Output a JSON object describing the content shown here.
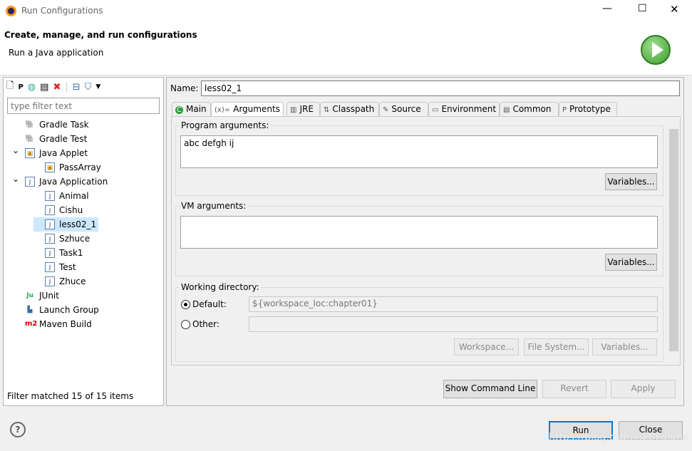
{
  "window": {
    "title": "Run Configurations"
  },
  "header": {
    "title": "Create, manage, and run configurations",
    "subtitle": "Run a Java application"
  },
  "toolbar": {
    "icons": [
      "new-config-icon",
      "new-prototype-icon",
      "duplicate-icon",
      "export-icon",
      "delete-icon",
      "collapse-all-icon",
      "filter-icon",
      "dropdown-icon"
    ]
  },
  "filter": {
    "placeholder": "type filter text"
  },
  "tree": [
    {
      "label": "Gradle Task",
      "icon": "gradle-icon",
      "level": 0
    },
    {
      "label": "Gradle Test",
      "icon": "gradle-icon",
      "level": 0
    },
    {
      "label": "Java Applet",
      "icon": "applet-icon",
      "level": 0,
      "expanded": true
    },
    {
      "label": "PassArray",
      "icon": "applet-icon",
      "level": 1
    },
    {
      "label": "Java Application",
      "icon": "java-app-icon",
      "level": 0,
      "expanded": true
    },
    {
      "label": "Animal",
      "icon": "java-app-icon",
      "level": 1
    },
    {
      "label": "Cishu",
      "icon": "java-app-icon",
      "level": 1
    },
    {
      "label": "less02_1",
      "icon": "java-app-icon",
      "level": 1,
      "selected": true
    },
    {
      "label": "Szhuce",
      "icon": "java-app-icon",
      "level": 1
    },
    {
      "label": "Task1",
      "icon": "java-app-icon",
      "level": 1
    },
    {
      "label": "Test",
      "icon": "java-app-icon",
      "level": 1
    },
    {
      "label": "Zhuce",
      "icon": "java-app-icon",
      "level": 1
    },
    {
      "label": "JUnit",
      "icon": "junit-icon",
      "level": 0
    },
    {
      "label": "Launch Group",
      "icon": "launch-group-icon",
      "level": 0
    },
    {
      "label": "Maven Build",
      "icon": "maven-icon",
      "level": 0
    }
  ],
  "status": "Filter matched 15 of 15 items",
  "name": {
    "label": "Name:",
    "value": "less02_1"
  },
  "tabs": [
    {
      "label": "Main",
      "icon": "C"
    },
    {
      "label": "Arguments",
      "icon": "(x)="
    },
    {
      "label": "JRE",
      "icon": "▥"
    },
    {
      "label": "Classpath",
      "icon": "⇅"
    },
    {
      "label": "Source",
      "icon": "✎"
    },
    {
      "label": "Environment",
      "icon": "▭"
    },
    {
      "label": "Common",
      "icon": "▤"
    },
    {
      "label": "Prototype",
      "icon": "P"
    }
  ],
  "arguments": {
    "program_label": "Program arguments:",
    "program_value": "abc defgh ij",
    "variables": "Variables...",
    "vm_label": "VM arguments:",
    "vm_value": "",
    "workdir_label": "Working directory:",
    "default_label": "Default:",
    "default_value": "${workspace_loc:chapter01}",
    "other_label": "Other:",
    "other_value": "",
    "workspace": "Workspace...",
    "filesystem": "File System..."
  },
  "actions": {
    "show_cmd": "Show Command Line",
    "revert": "Revert",
    "apply": "Apply",
    "run": "Run",
    "close": "Close"
  },
  "watermark": "https://blog.csdn.net/Lulutia"
}
